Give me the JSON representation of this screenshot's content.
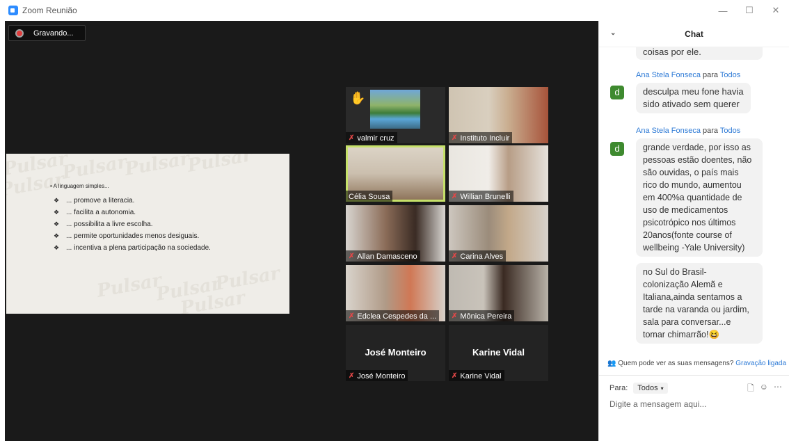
{
  "window": {
    "title": "Zoom Reunião",
    "minimize": "—",
    "maximize": "☐",
    "close": "✕"
  },
  "recording": {
    "label": "Gravando..."
  },
  "slide": {
    "heading": "• A linguagem simples...",
    "items": [
      "... promove a literacia.",
      "... facilita a autonomia.",
      "... possibilita a livre escolha.",
      "... permite oportunidades menos desiguais.",
      "... incentiva a plena participação na sociedade."
    ],
    "watermark": "Pulsar",
    "bullet_glyph": "❖"
  },
  "participants": [
    {
      "name": "valmir cruz",
      "muted": true,
      "hand_raised": true
    },
    {
      "name": "Instituto Incluir",
      "muted": true
    },
    {
      "name": "Célia Sousa",
      "muted": false,
      "active_speaker": true
    },
    {
      "name": "Willian Brunelli",
      "muted": true
    },
    {
      "name": "Allan Damasceno",
      "muted": true
    },
    {
      "name": "Carina Alves",
      "muted": true
    },
    {
      "name": "Edclea Cespedes da ...",
      "muted": true
    },
    {
      "name": "Mônica Pereira",
      "muted": true
    },
    {
      "name": "José Monteiro",
      "muted": true,
      "video_off": true
    },
    {
      "name": "Karine Vidal",
      "muted": true,
      "video_off": true
    }
  ],
  "chat": {
    "title": "Chat",
    "top_partial": "coisas por ele.",
    "messages": [
      {
        "sender": "Ana Stela Fonseca",
        "to_word": "para",
        "recipient": "Todos",
        "avatar": "d",
        "texts": [
          "desculpa meu fone havia\nsido ativado sem querer"
        ]
      },
      {
        "sender": "Ana Stela Fonseca",
        "to_word": "para",
        "recipient": "Todos",
        "avatar": "d",
        "texts": [
          "grande verdade, por isso as\npessoas estão doentes, não\nsão ouvidas, o país mais\nrico do mundo, aumentou\nem 400%a quantidade de\nuso de medicamentos\npsicotrópico nos últimos\n20anos(fonte course of\nwellbeing -Yale University)",
          "no Sul do Brasil-\ncolonização Alemã e\nItaliana,ainda sentamos a\ntarde na varanda ou jardim,\nsala para conversar...e\ntomar chimarrão!😆"
        ]
      }
    ],
    "notice": {
      "text": "Quem pode ver as suas mensagens?",
      "link": "Gravação ligada"
    },
    "to_label": "Para:",
    "to_value": "Todos",
    "placeholder": "Digite a mensagem aqui..."
  }
}
